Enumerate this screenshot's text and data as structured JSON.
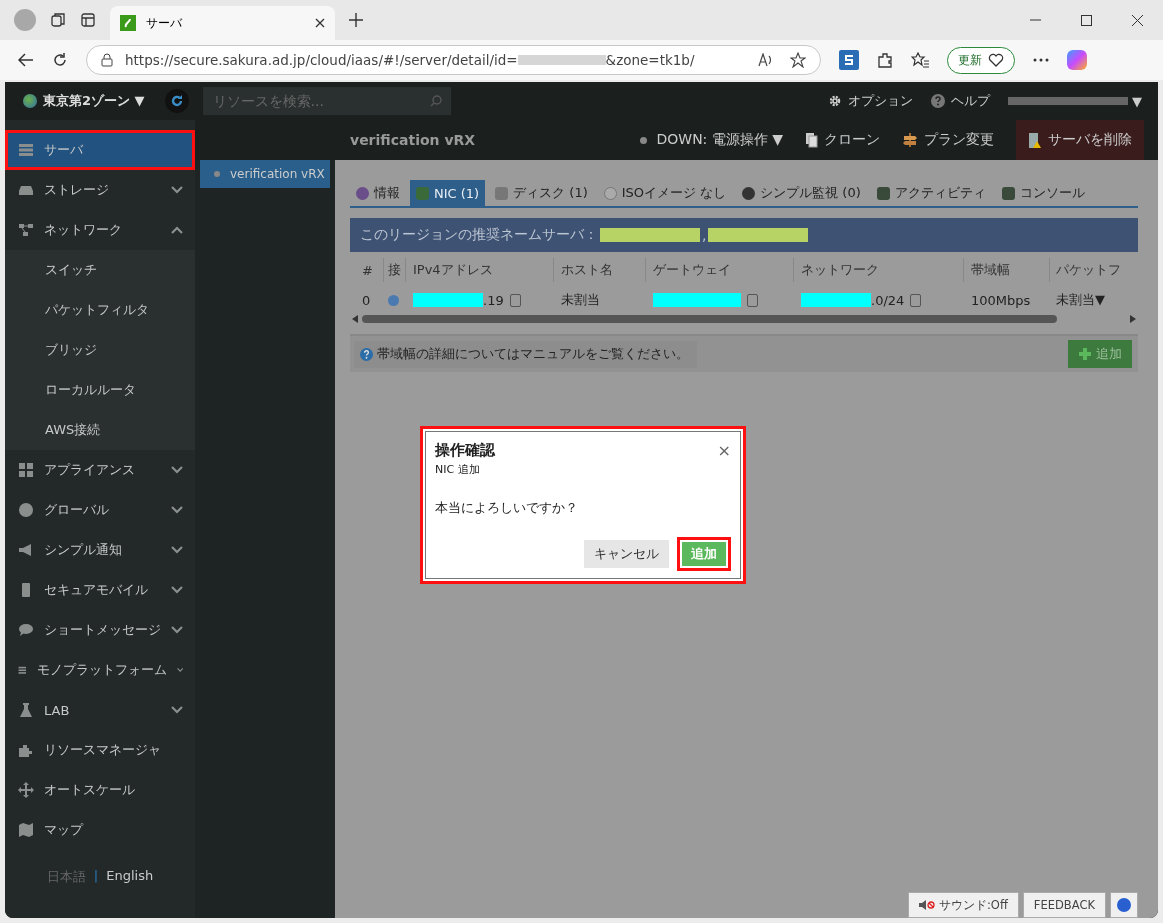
{
  "browser": {
    "tab_title": "サーバ",
    "url_prefix": "https://secure.sakura.ad.jp/cloud/iaas/#!/server/detail/id=",
    "url_suffix": "&zone=tk1b/",
    "update_button": "更新"
  },
  "topbar": {
    "zone": "東京第2ゾーン ▼",
    "search_placeholder": "リソースを検索...",
    "options": "オプション",
    "help": "ヘルプ",
    "user_caret": "▼"
  },
  "sidebar": {
    "items": [
      {
        "label": "サーバ",
        "selected": true,
        "highlighted": true
      },
      {
        "label": "ストレージ",
        "selected": false,
        "expanded": false
      },
      {
        "label": "ネットワーク",
        "selected": false,
        "expanded": true,
        "children": [
          {
            "label": "スイッチ"
          },
          {
            "label": "パケットフィルタ"
          },
          {
            "label": "ブリッジ"
          },
          {
            "label": "ローカルルータ"
          },
          {
            "label": "AWS接続"
          }
        ]
      },
      {
        "label": "アプライアンス",
        "selected": false,
        "expanded": false
      },
      {
        "label": "グローバル",
        "selected": false,
        "expanded": false
      },
      {
        "label": "シンプル通知",
        "selected": false,
        "expanded": false
      },
      {
        "label": "セキュアモバイル",
        "selected": false,
        "expanded": false
      },
      {
        "label": "ショートメッセージ",
        "selected": false,
        "expanded": false
      },
      {
        "label": "モノプラットフォーム",
        "selected": false,
        "expanded": false
      },
      {
        "label": "LAB",
        "selected": false,
        "expanded": false
      },
      {
        "label": "リソースマネージャ",
        "selected": false
      },
      {
        "label": "オートスケール",
        "selected": false
      },
      {
        "label": "マップ",
        "selected": false
      }
    ],
    "languages": [
      {
        "label": "日本語",
        "selected": true
      },
      {
        "label": "English",
        "selected": false
      }
    ],
    "language_separator": "|"
  },
  "server_list": [
    {
      "name": "verification vRX",
      "selected": true
    }
  ],
  "header": {
    "title": "verification vRX",
    "status": "DOWN: 電源操作 ▼",
    "actions": [
      {
        "label": "クローン",
        "kind": "clone"
      },
      {
        "label": "プラン変更",
        "kind": "plan"
      },
      {
        "label": "サーバを削除",
        "kind": "delete"
      }
    ]
  },
  "tabs": [
    {
      "label": "情報",
      "selected": false
    },
    {
      "label": "NIC (1)",
      "selected": true
    },
    {
      "label": "ディスク (1)",
      "selected": false
    },
    {
      "label": "ISOイメージ なし",
      "selected": false
    },
    {
      "label": "シンプル監視 (0)",
      "selected": false
    },
    {
      "label": "アクティビティ",
      "selected": false
    },
    {
      "label": "コンソール",
      "selected": false
    }
  ],
  "nameserver": {
    "label": "このリージョンの推奨ネームサーバ：",
    "separator": ","
  },
  "table": {
    "columns": [
      "#",
      "接",
      "IPv4アドレス",
      "ホスト名",
      "ゲートウェイ",
      "ネットワーク",
      "帯域幅",
      "パケットフ"
    ],
    "rows": [
      {
        "index": "0",
        "ip_suffix": ".19",
        "hostname": "未割当",
        "network_suffix": ".0/24",
        "bandwidth": "100Mbps",
        "packet_filter": "未割当",
        "packet_filter_caret": "▼"
      }
    ]
  },
  "notice": "帯域幅の詳細についてはマニュアルをご覧ください。",
  "add_button": "追加",
  "dialog": {
    "title": "操作確認",
    "subtitle": "NIC 追加",
    "message": "本当によろしいですか？",
    "close": "×",
    "highlighted": true,
    "buttons": [
      {
        "label": "キャンセル",
        "kind": "secondary",
        "highlighted": false
      },
      {
        "label": "追加",
        "kind": "primary",
        "highlighted": true
      }
    ]
  },
  "footer": {
    "sound": "サウンド:Off",
    "feedback": "FEEDBACK"
  }
}
